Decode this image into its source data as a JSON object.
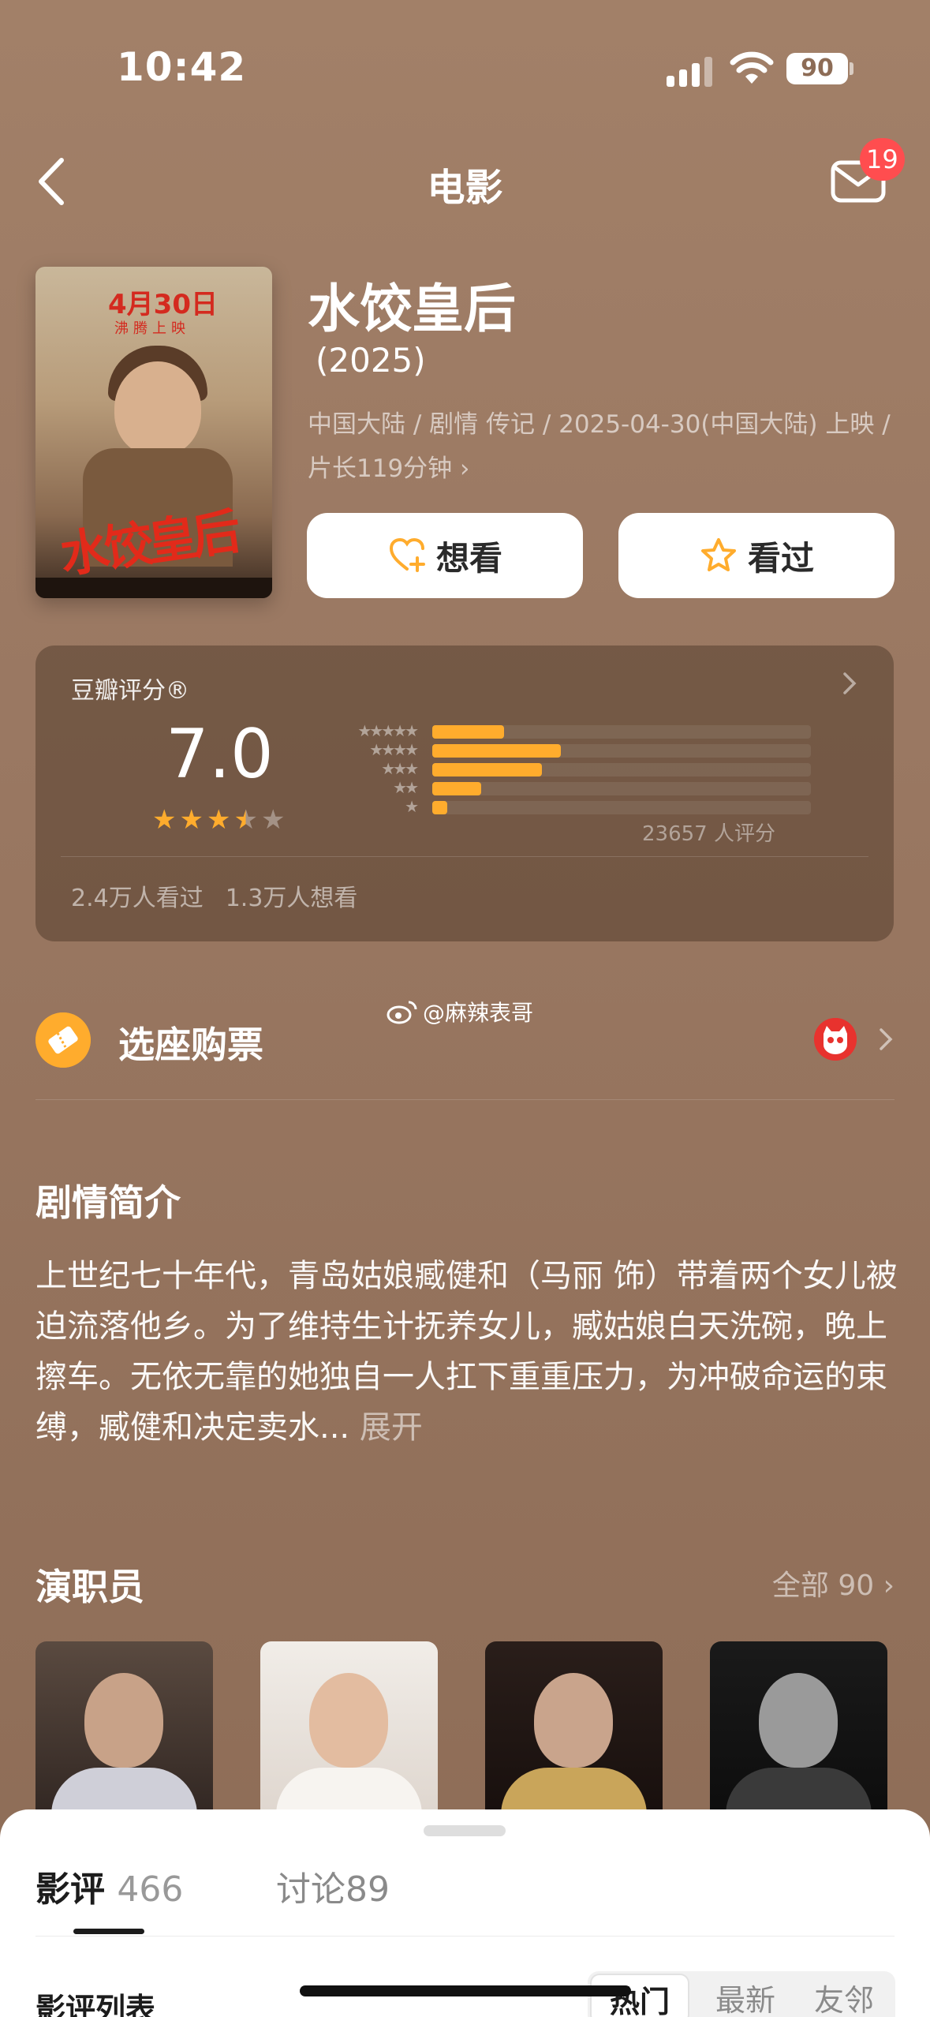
{
  "status_bar": {
    "time": "10:42",
    "battery": "90"
  },
  "nav": {
    "title": "电影",
    "mail_badge": "19"
  },
  "movie": {
    "poster_date": "4月30日",
    "poster_sub": "沸腾上映",
    "poster_title": "水饺皇后",
    "title": "水饺皇后",
    "year": "(2025)",
    "meta": "中国大陆 / 剧情 传记 / 2025-04-30(中国大陆) 上映 / 片长119分钟 ›",
    "want_label": "想看",
    "seen_label": "看过"
  },
  "rating": {
    "label": "豆瓣评分®",
    "score": "7.0",
    "stars_value": 3.5,
    "distribution": [
      {
        "stars": "★★★★★",
        "fraction": 0.19
      },
      {
        "stars": "★★★★",
        "fraction": 0.34
      },
      {
        "stars": "★★★",
        "fraction": 0.29
      },
      {
        "stars": "★★",
        "fraction": 0.13
      },
      {
        "stars": "★",
        "fraction": 0.04
      }
    ],
    "count": "23657 人评分",
    "watched": "2.4万人看过",
    "want": "1.3万人想看"
  },
  "ticket": {
    "label": "选座购票",
    "watermark": "@麻辣表哥"
  },
  "synopsis": {
    "title": "剧情简介",
    "text": "上世纪七十年代，青岛姑娘臧健和（马丽 饰）带着两个女儿被迫流落他乡。为了维持生计抚养女儿，臧姑娘白天洗碗，晚上擦车。无依无靠的她独自一人扛下重重压力，为冲破命运的束缚，臧健和决定卖水...",
    "expand": "展开"
  },
  "cast": {
    "title": "演职员",
    "all": "全部 90 ›"
  },
  "sheet": {
    "tab_reviews": "影评",
    "tab_reviews_count": "466",
    "tab_discuss": "讨论89",
    "list_title": "影评列表",
    "seg_hot": "热门",
    "seg_new": "最新",
    "seg_friend": "友邻"
  },
  "colors": {
    "accent": "#ffac2d",
    "badge": "#ff4d4f",
    "background": "#9a7862"
  }
}
